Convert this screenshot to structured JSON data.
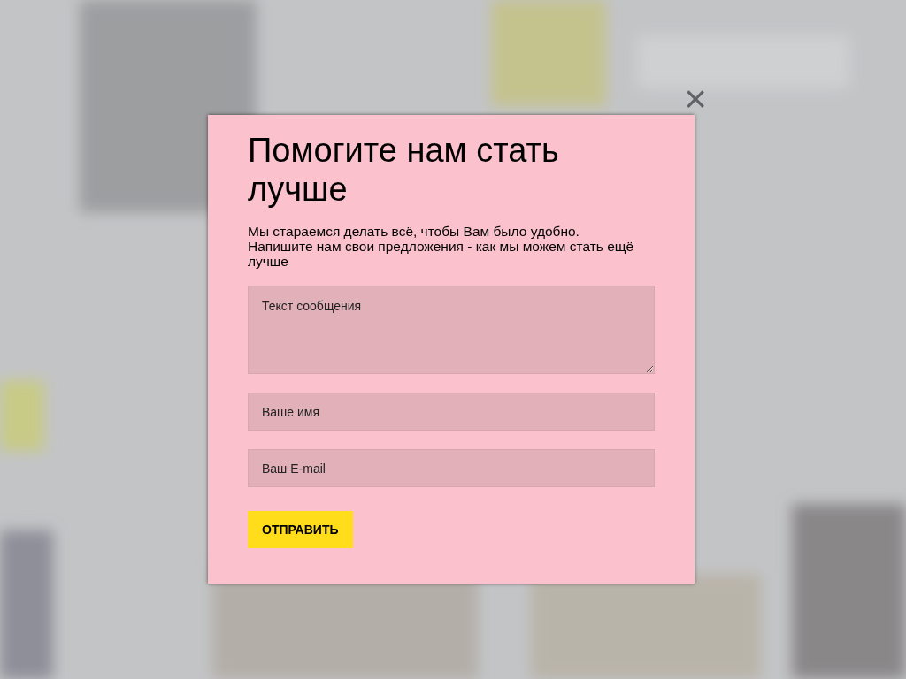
{
  "modal": {
    "close": "×",
    "title": "Помогите нам стать лучше",
    "description": "Мы стараемся делать всё, чтобы Вам было удобно. Напишите нам свои предложения - как мы можем стать ещё лучше",
    "fields": [
      {
        "kind": "textarea",
        "placeholder": "Текст сообщения"
      },
      {
        "kind": "input",
        "placeholder": "Ваше имя"
      },
      {
        "kind": "input",
        "placeholder": "Ваш E-mail"
      }
    ],
    "submit": "ОТПРАВИТЬ"
  }
}
